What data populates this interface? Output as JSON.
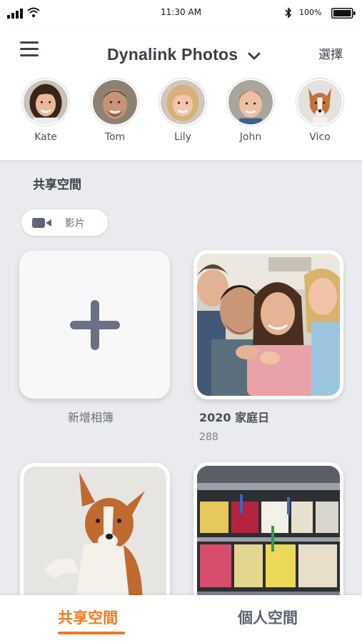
{
  "status_bar": {
    "time": "11:30 AM",
    "battery": "100%"
  },
  "header": {
    "title": "Dynalink Photos",
    "select_label": "選擇"
  },
  "people": [
    {
      "name": "Kate"
    },
    {
      "name": "Tom"
    },
    {
      "name": "Lily"
    },
    {
      "name": "John"
    },
    {
      "name": "Vico"
    }
  ],
  "section": {
    "title": "共享空間",
    "filter_chip": "影片"
  },
  "albums": [
    {
      "label": "新增相簿"
    },
    {
      "label": "2020 家庭日",
      "count": "288"
    }
  ],
  "bottom_nav": {
    "tabs": [
      {
        "label": "共享空間",
        "active": true
      },
      {
        "label": "個人空間",
        "active": false
      }
    ]
  },
  "colors": {
    "accent": "#f07a21",
    "text_dark": "#3b3f4a",
    "plus": "#6a7085",
    "background": "#e9ebee"
  },
  "icons": [
    "signal-icon",
    "wifi-icon",
    "bluetooth-icon",
    "battery-icon",
    "menu-icon",
    "chevron-down-icon",
    "video-camera-icon",
    "plus-icon"
  ]
}
